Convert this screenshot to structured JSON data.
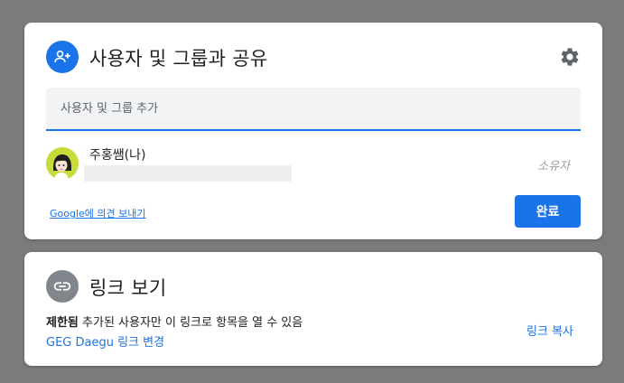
{
  "share": {
    "title": "사용자 및 그룹과 공유",
    "icon": "person-add-icon",
    "input_placeholder": "사용자 및 그룹 추가",
    "input_value": "",
    "person": {
      "name": "주홍쌤(나)",
      "role": "소유자",
      "avatar": "cartoon-avatar"
    },
    "feedback_link": "Google에 의견 보내기",
    "done_label": "완료"
  },
  "link": {
    "title": "링크 보기",
    "icon": "link-icon",
    "restriction_bold": "제한됨",
    "restriction_text": " 추가된 사용자만 이 링크로 항목을 열 수 있음",
    "change_label": "GEG Daegu 링크 변경",
    "copy_label": "링크 복사"
  },
  "colors": {
    "accent": "#1a73e8",
    "link_icon_bg": "#80868b",
    "overlay": "#7b7b7b"
  }
}
